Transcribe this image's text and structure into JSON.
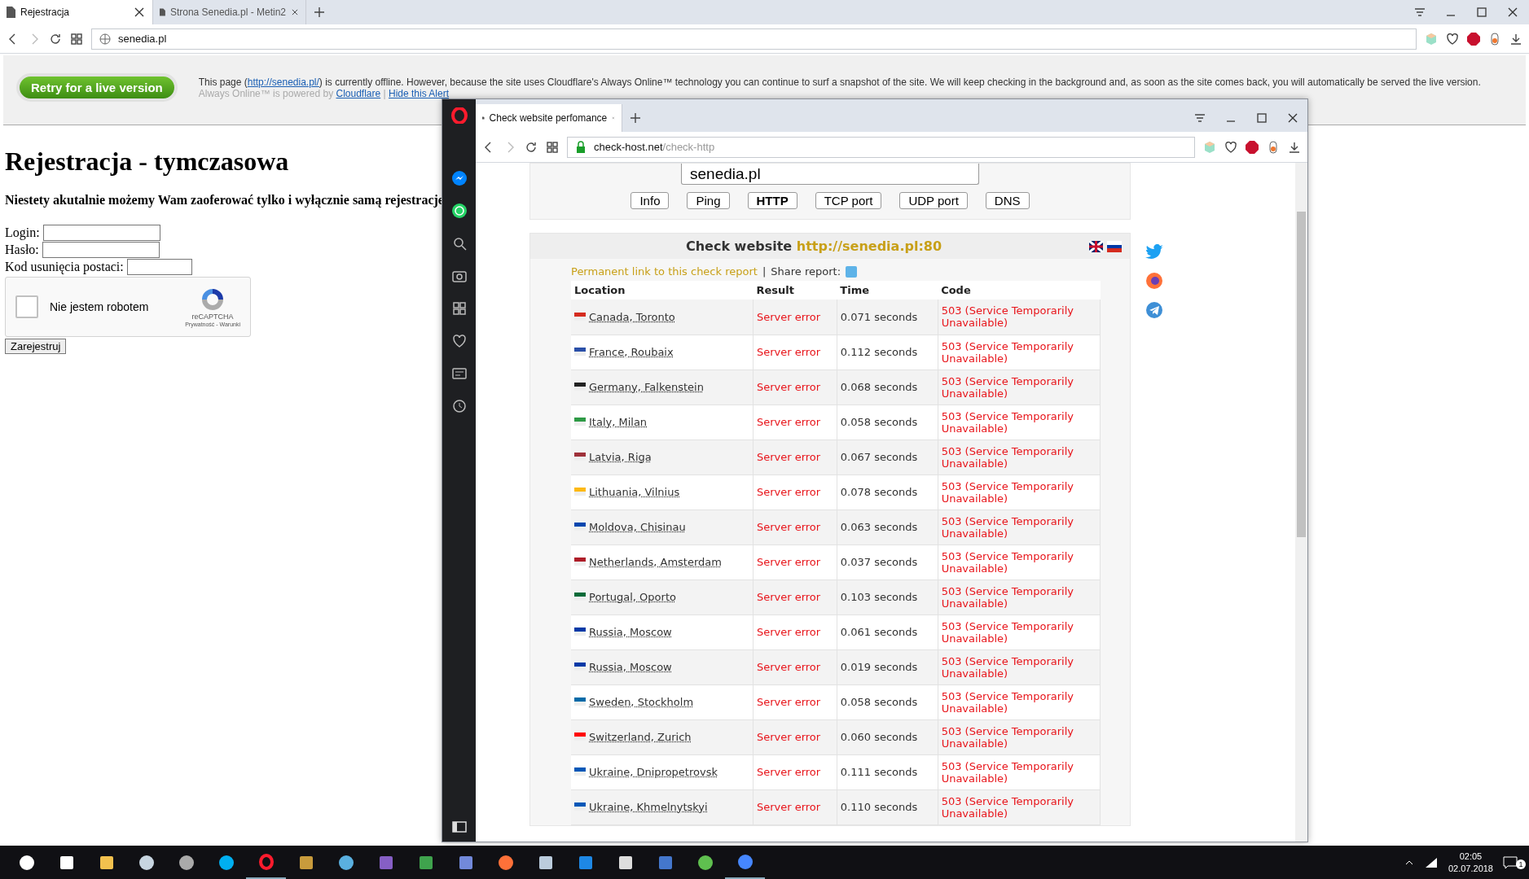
{
  "browser": {
    "tabs": [
      {
        "title": "Rejestracja",
        "selected": true
      },
      {
        "title": "Strona Senedia.pl - Metin2",
        "selected": false
      }
    ],
    "address": "senedia.pl"
  },
  "alert": {
    "button": "Retry for a live version",
    "text_before": "This page (",
    "site_link": "http://senedia.pl/",
    "text_after": ") is currently offline. However, because the site uses Cloudflare's Always Online™ technology you can continue to surf a snapshot of the site. We will keep checking in the background and, as soon as the site comes back, you will automatically be served the live version.",
    "note": "Always Online™ is powered by",
    "provider_link": "Cloudflare",
    "separator": "|",
    "hide_link": "Hide this Alert"
  },
  "page": {
    "heading": "Rejestracja - tymczasowa",
    "notice": "Niestety akutalnie możemy Wam zaoferować tylko i wyłącznie samą rejestracje",
    "fields": [
      {
        "label": "Login:"
      },
      {
        "label": "Hasło:"
      },
      {
        "label": "Kod usunięcia postaci:"
      }
    ],
    "captcha": {
      "label": "Nie jestem robotem",
      "checked": false,
      "brand": "reCAPTCHA",
      "terms": "Prywatność - Warunki"
    },
    "submit": "Zarejestruj"
  },
  "popup": {
    "tab": "Check website perfomance",
    "host": "check-host.net",
    "path": "/check-http",
    "search": "senedia.pl",
    "modes": [
      {
        "label": "Info",
        "selected": false
      },
      {
        "label": "Ping",
        "selected": false
      },
      {
        "label": "HTTP",
        "selected": true
      },
      {
        "label": "TCP port",
        "selected": false
      },
      {
        "label": "UDP port",
        "selected": false
      },
      {
        "label": "DNS",
        "selected": false
      }
    ],
    "check_title": "Check website",
    "check_url": "http://senedia.pl:80",
    "permalink": "Permanent link to this check report",
    "separator": "|",
    "share": "Share report:",
    "columns": [
      "Location",
      "Result",
      "Time",
      "Code"
    ],
    "rows": [
      {
        "location": "Canada, Toronto",
        "color": "#d52b1e",
        "result": "Server error",
        "time": "0.071 seconds",
        "code": "503 (Service Temporarily Unavailable)"
      },
      {
        "location": "France, Roubaix",
        "color": "#2a4fa8",
        "result": "Server error",
        "time": "0.112 seconds",
        "code": "503 (Service Temporarily Unavailable)"
      },
      {
        "location": "Germany, Falkenstein",
        "color": "#222222",
        "result": "Server error",
        "time": "0.068 seconds",
        "code": "503 (Service Temporarily Unavailable)"
      },
      {
        "location": "Italy, Milan",
        "color": "#2e9a45",
        "result": "Server error",
        "time": "0.058 seconds",
        "code": "503 (Service Temporarily Unavailable)"
      },
      {
        "location": "Latvia, Riga",
        "color": "#9e3039",
        "result": "Server error",
        "time": "0.067 seconds",
        "code": "503 (Service Temporarily Unavailable)"
      },
      {
        "location": "Lithuania, Vilnius",
        "color": "#fdb913",
        "result": "Server error",
        "time": "0.078 seconds",
        "code": "503 (Service Temporarily Unavailable)"
      },
      {
        "location": "Moldova, Chisinau",
        "color": "#0046ae",
        "result": "Server error",
        "time": "0.063 seconds",
        "code": "503 (Service Temporarily Unavailable)"
      },
      {
        "location": "Netherlands, Amsterdam",
        "color": "#ae1c28",
        "result": "Server error",
        "time": "0.037 seconds",
        "code": "503 (Service Temporarily Unavailable)"
      },
      {
        "location": "Portugal, Oporto",
        "color": "#046a38",
        "result": "Server error",
        "time": "0.103 seconds",
        "code": "503 (Service Temporarily Unavailable)"
      },
      {
        "location": "Russia, Moscow",
        "color": "#0039a6",
        "result": "Server error",
        "time": "0.061 seconds",
        "code": "503 (Service Temporarily Unavailable)"
      },
      {
        "location": "Russia, Moscow",
        "color": "#0039a6",
        "result": "Server error",
        "time": "0.019 seconds",
        "code": "503 (Service Temporarily Unavailable)"
      },
      {
        "location": "Sweden, Stockholm",
        "color": "#006aa7",
        "result": "Server error",
        "time": "0.058 seconds",
        "code": "503 (Service Temporarily Unavailable)"
      },
      {
        "location": "Switzerland, Zurich",
        "color": "#ff0000",
        "result": "Server error",
        "time": "0.060 seconds",
        "code": "503 (Service Temporarily Unavailable)"
      },
      {
        "location": "Ukraine, Dnipropetrovsk",
        "color": "#0057b7",
        "result": "Server error",
        "time": "0.111 seconds",
        "code": "503 (Service Temporarily Unavailable)"
      },
      {
        "location": "Ukraine, Khmelnytskyi",
        "color": "#0057b7",
        "result": "Server error",
        "time": "0.110 seconds",
        "code": "503 (Service Temporarily Unavailable)"
      }
    ]
  },
  "taskbar": {
    "time": "02:05",
    "date": "02.07.2018",
    "notifications": "1"
  }
}
